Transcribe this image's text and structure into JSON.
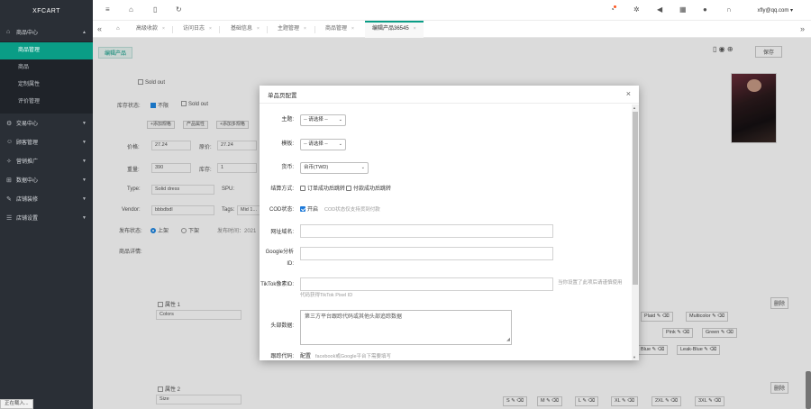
{
  "sidebar": {
    "brand": "XFCART",
    "groups": [
      {
        "label": "商品中心",
        "caret": "▲",
        "subitems": [
          "商品管理",
          "商品",
          "定制属性",
          "评价管理"
        ]
      },
      {
        "label": "交易中心",
        "caret": "▼"
      },
      {
        "label": "顾客管理",
        "caret": "▼"
      },
      {
        "label": "营销推广",
        "caret": "▼"
      },
      {
        "label": "数据中心",
        "caret": "▼"
      },
      {
        "label": "店铺装修",
        "caret": "▼"
      },
      {
        "label": "店铺设置",
        "caret": "▼"
      }
    ],
    "status": "正在载入..."
  },
  "topbar": {
    "user": "xfly@qq.com ▾"
  },
  "tabs": {
    "items": [
      "高级收款",
      "访问日志",
      "基础信息",
      "主题管理",
      "商品管理",
      "编辑产品36545"
    ],
    "nav_left": "«",
    "nav_right": "»",
    "home_icon": "⌂"
  },
  "bg": {
    "edit_tab": "编辑产品",
    "sold_out_1": "Sold out",
    "stock_label": "库存状态:",
    "opt_default": "不限",
    "sold_out_2": "Sold out",
    "small_buttons": [
      "+添加规格",
      "产品属性",
      "+添加多规格"
    ],
    "price_label": "价格:",
    "price_value": "27.24",
    "compare_label": "原价:",
    "compare_value": "27.24",
    "weight_label": "重量:",
    "weight_value": "390",
    "stock_qty_label": "库存:",
    "stock_qty_value": "1",
    "type_label": "Type:",
    "type_value": "Solid dress",
    "sku_label": "SPU:",
    "vendor_label": "Vendor:",
    "vendor_value": "bbbdbdl",
    "tags_label": "Tags:",
    "tags_value": "Mid 1...",
    "publish_label": "发布状态:",
    "publish_on": "上架",
    "publish_off": "下架",
    "publish_time": "发布时间：2021",
    "detail_label": "商品详情:",
    "attr1_label": "属性 1",
    "attr1_value": "Colors",
    "attr2_label": "属性 2",
    "attr2_value": "Size",
    "delete_btn": "删除",
    "chips_row1": [
      "Plaid",
      "Multicolor"
    ],
    "chips_row2": [
      "Pink",
      "Green"
    ],
    "chips_row3": [
      "Blue",
      "Leak-Blue"
    ],
    "sizes": [
      "S",
      "M",
      "L",
      "XL",
      "2XL",
      "3XL"
    ],
    "save_btn": "保存"
  },
  "modal": {
    "title": "单品页配置",
    "close": "×",
    "theme_label": "主题:",
    "theme_value": "-- 请选择 --",
    "theme2_label": "模板:",
    "theme2_value": "-- 请选择 --",
    "currency_label": "货币:",
    "currency_value": "台币(TWD)",
    "checkout_label": "结算方式:",
    "checkout_opt1": "订单成功后跳转",
    "checkout_opt2": "付款成功后跳转",
    "cod_label": "COD状态:",
    "cod_opt": "开启",
    "cod_hint": "COD状态仅支持货到付款",
    "domain_label": "网址域名:",
    "google_label": "Google分析ID:",
    "tiktok_label": "TikTok像素ID:",
    "tiktok_hint": "代码获得TikTok Pixel ID",
    "tiktok_hint_right": "当你设置了此项后请谨慎使用",
    "header_label": "头部数据:",
    "header_placeholder": "第三方平台跟踪代码或其他头部追踪数据",
    "tracking_label": "跟踪代码:",
    "tracking_value": "配置",
    "tracking_hint": "facebook或Google平台下需要填写"
  }
}
